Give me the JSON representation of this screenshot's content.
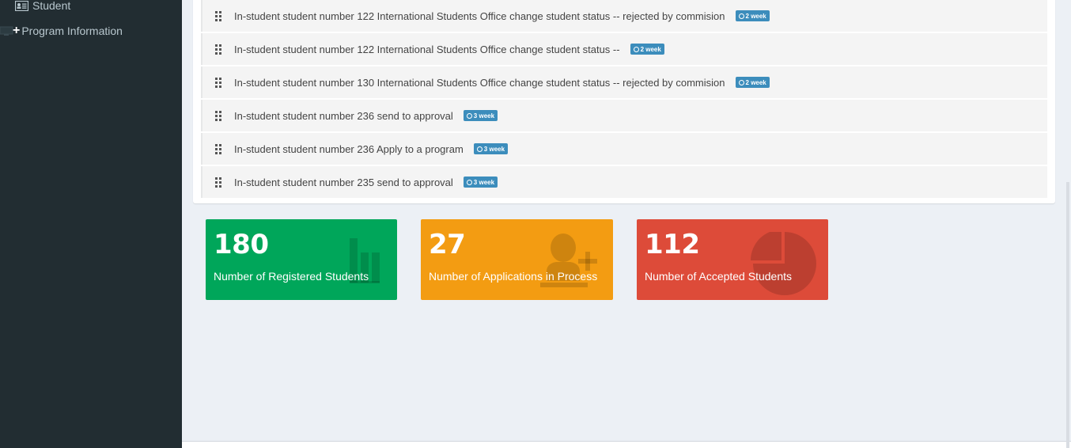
{
  "sidebar": {
    "items": [
      {
        "label": "Student",
        "icon": "id-card-icon"
      },
      {
        "label": "Program Information",
        "icon": "plus-icon"
      }
    ]
  },
  "todo": {
    "items": [
      {
        "text": "In-student student number 122 International Students Office change student status -- rejected by commision",
        "badge": "2 week"
      },
      {
        "text": "In-student student number 122 International Students Office change student status --",
        "badge": "2 week"
      },
      {
        "text": "In-student student number 130 International Students Office change student status -- rejected by commision",
        "badge": "2 week"
      },
      {
        "text": "In-student student number 236 send to approval",
        "badge": "3 week"
      },
      {
        "text": "In-student student number 236 Apply to a program",
        "badge": "3 week"
      },
      {
        "text": "In-student student number 235 send to approval",
        "badge": "3 week"
      }
    ],
    "badge_color": "#3c8dbc"
  },
  "tiles": [
    {
      "value": "180",
      "label": "Number of Registered Students",
      "color": "#00a65a",
      "icon": "bar-chart-icon"
    },
    {
      "value": "27",
      "label": "Number of Applications in Process",
      "color": "#f39c12",
      "icon": "user-plus-icon"
    },
    {
      "value": "112",
      "label": "Number of Accepted Students",
      "color": "#dd4b39",
      "icon": "pie-chart-icon"
    }
  ]
}
